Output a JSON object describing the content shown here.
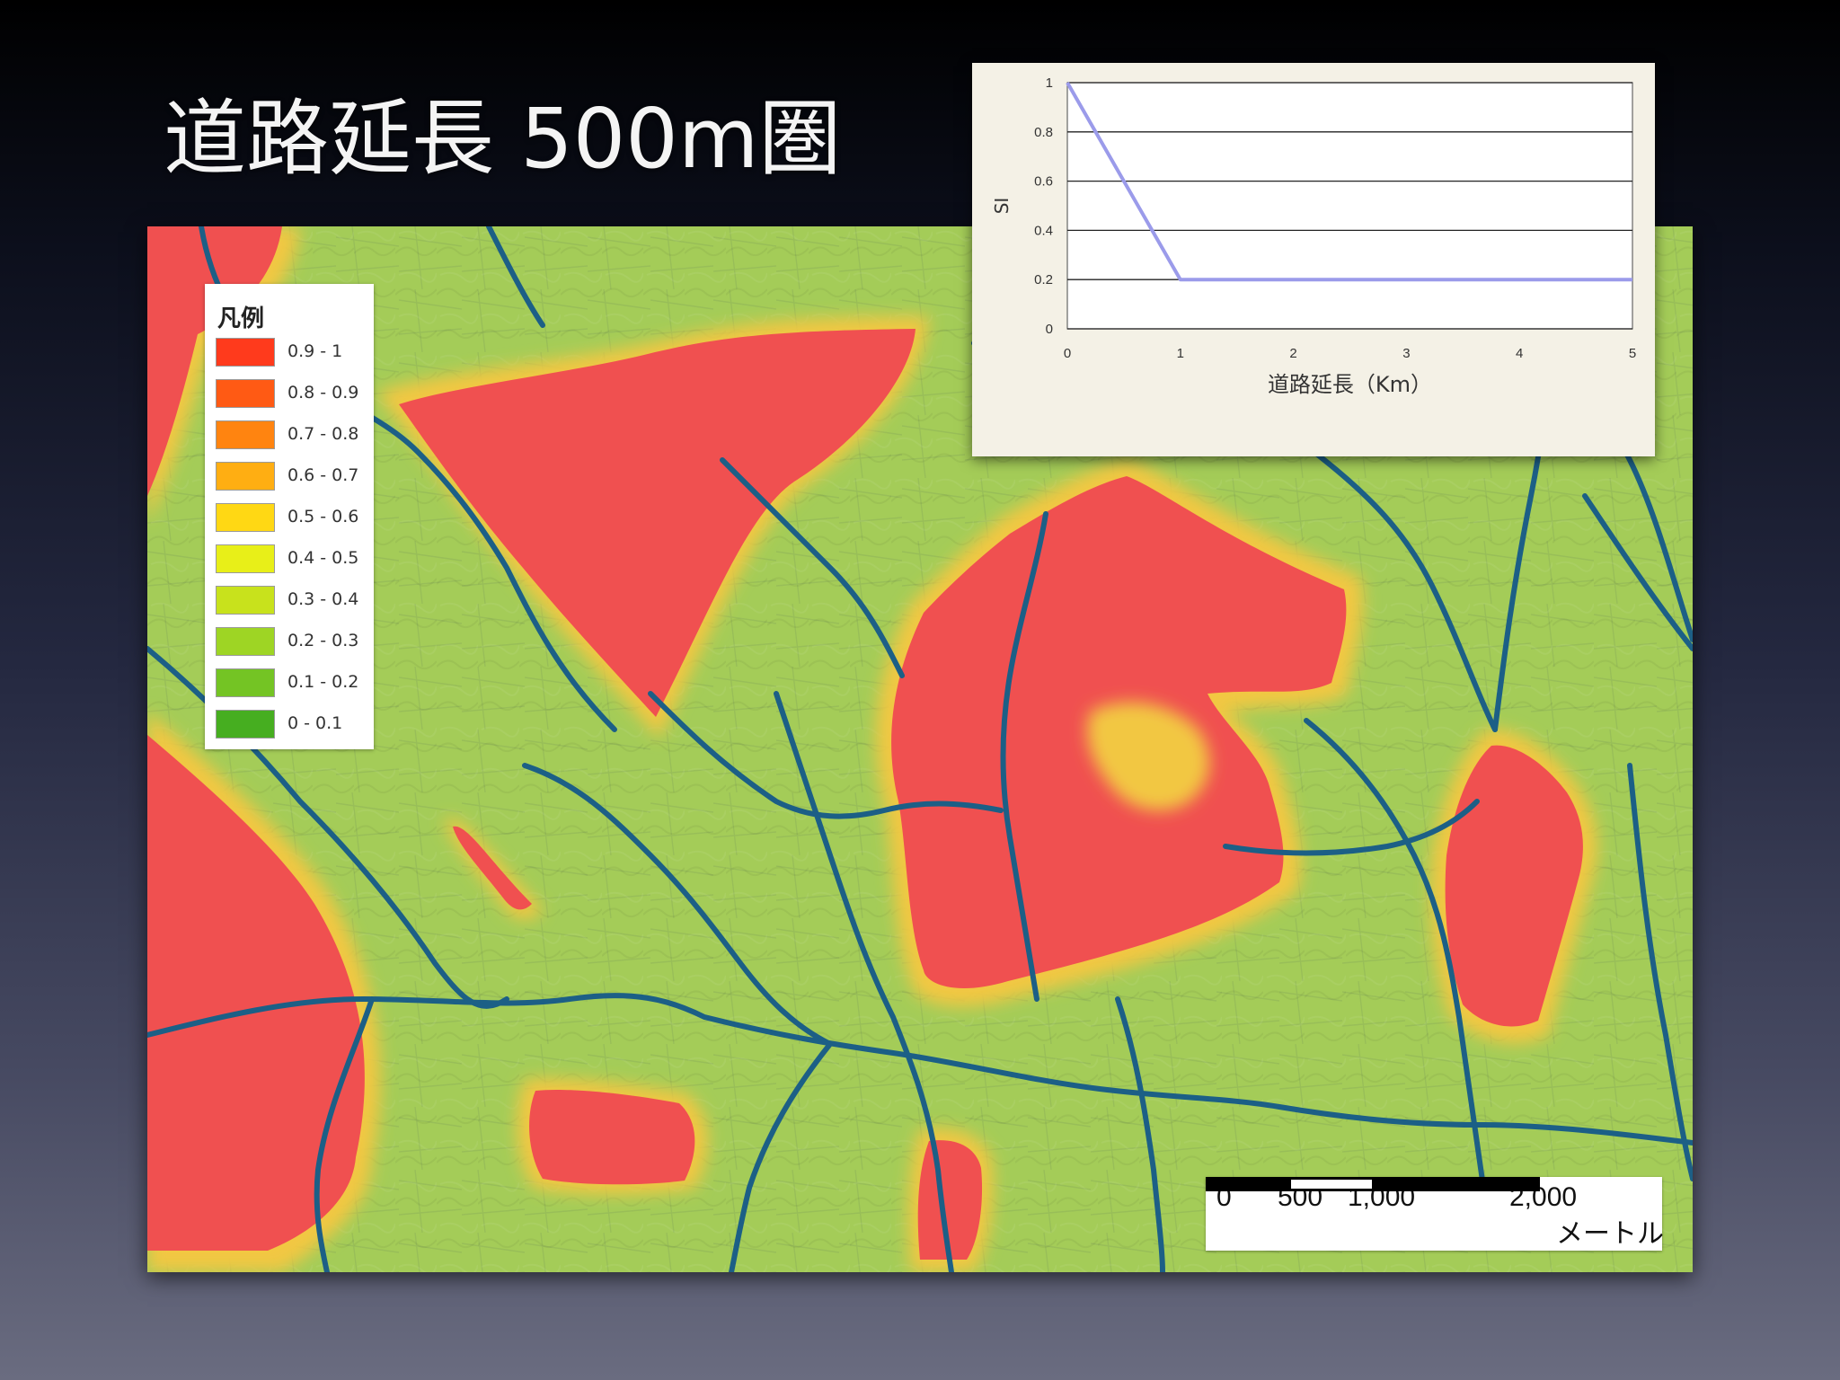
{
  "slide": {
    "title": "道路延長 500m圏"
  },
  "colors": {
    "suitability_high": "#f05050",
    "suitability_mid": "#f3c640",
    "suitability_low": "#a4cc58",
    "road": "#1c5f86",
    "chart_line": "#9b9bea"
  },
  "map": {
    "legend": {
      "title": "凡例",
      "items": [
        {
          "label": "0.9 - 1",
          "color": "#ff3a1c"
        },
        {
          "label": "0.8 - 0.9",
          "color": "#ff5a14"
        },
        {
          "label": "0.7 - 0.8",
          "color": "#ff8410"
        },
        {
          "label": "0.6 - 0.7",
          "color": "#ffae12"
        },
        {
          "label": "0.5 - 0.6",
          "color": "#ffd814"
        },
        {
          "label": "0.4 - 0.5",
          "color": "#e8ef18"
        },
        {
          "label": "0.3 - 0.4",
          "color": "#c8e21c"
        },
        {
          "label": "0.2 - 0.3",
          "color": "#9ed524"
        },
        {
          "label": "0.1 - 0.2",
          "color": "#74c424"
        },
        {
          "label": "0 - 0.1",
          "color": "#46ae20"
        }
      ]
    },
    "scalebar": {
      "ticks": [
        "0",
        "500",
        "1,000",
        "2,000"
      ],
      "unit": "メートル"
    }
  },
  "chart_data": {
    "type": "line",
    "title": "",
    "xlabel": "道路延長（Km）",
    "ylabel": "SI",
    "x_ticks": [
      "0",
      "1",
      "2",
      "3",
      "4",
      "5"
    ],
    "y_ticks": [
      "0",
      "0.2",
      "0.4",
      "0.6",
      "0.8",
      "1"
    ],
    "xlim": [
      0,
      5
    ],
    "ylim": [
      0,
      1
    ],
    "grid": "horizontal",
    "series": [
      {
        "x": [
          0,
          1,
          5
        ],
        "y": [
          1,
          0.2,
          0.2
        ]
      }
    ]
  }
}
